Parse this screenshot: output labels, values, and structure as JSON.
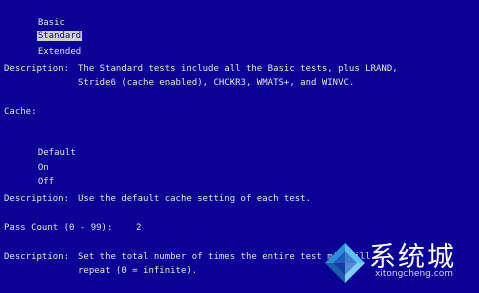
{
  "test_mix": {
    "options": [
      "Basic",
      "Standard",
      "Extended"
    ],
    "selected": "Standard",
    "description_label": "Description:",
    "description_lines": [
      "The Standard tests include all the Basic tests, plus LRAND,",
      "Stride6 (cache enabled), CHCKR3, WMATS+, and WINVC."
    ]
  },
  "cache": {
    "label": "Cache:",
    "options": [
      "Default",
      "On",
      "Off"
    ],
    "description_label": "Description:",
    "description": "Use the default cache setting of each test."
  },
  "pass_count": {
    "label": "Pass Count (0 - 99):",
    "value": "2",
    "description_label": "Description:",
    "description_lines": [
      "Set the total number of times the entire test mix will",
      "repeat (0 = infinite)."
    ]
  },
  "watermark": {
    "text": "系统城",
    "sub": "xitongcheng.com",
    "colors": [
      "#2a8fd8",
      "#5cc0f0",
      "#1b5fae",
      "#7fd0f5"
    ]
  }
}
